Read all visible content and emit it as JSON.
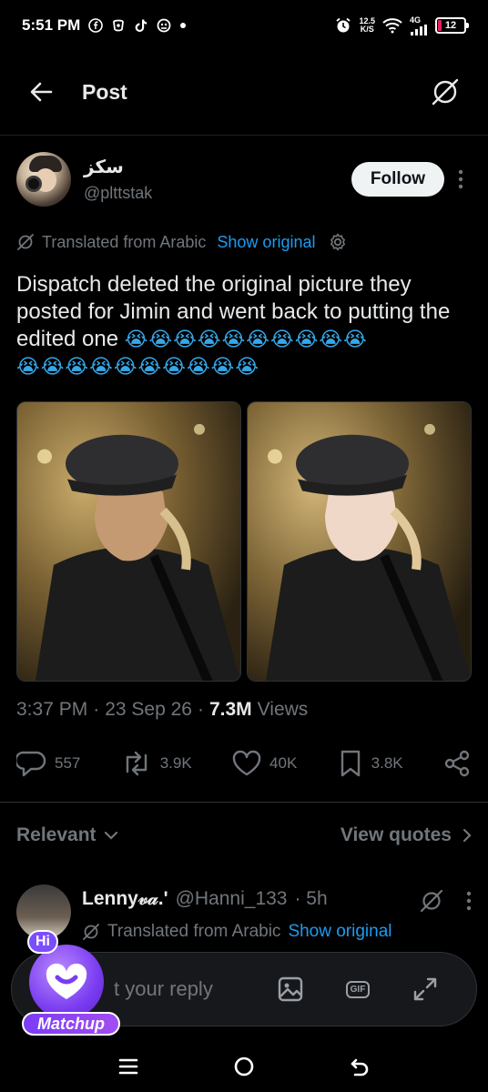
{
  "status_bar": {
    "time": "5:51 PM",
    "net_speed_value": "12.5",
    "net_speed_unit": "K/S",
    "network": "4G",
    "battery": "12"
  },
  "header": {
    "title": "Post"
  },
  "tweet": {
    "author_name": "سکز",
    "author_handle": "@plttstak",
    "follow_label": "Follow",
    "translated_label": "Translated from Arabic",
    "show_original": "Show original",
    "text": "Dispatch deleted the original picture they posted for Jimin and went back to putting the edited one",
    "emojis_line1": "😭😭😭😭😭😭😭😭😭😭",
    "emojis_line2": "😭😭😭😭😭😭😭😭😭😭",
    "time": "3:37 PM",
    "date": "23 Sep 26",
    "views_count": "7.3M",
    "views_label": "Views",
    "replies": "557",
    "reposts": "3.9K",
    "likes": "40K",
    "bookmarks": "3.8K"
  },
  "replies_section": {
    "sort_label": "Relevant",
    "quotes_label": "View quotes"
  },
  "reply": {
    "name": "Lenny𝓋𝒶.'",
    "handle": "@Hanni_133",
    "age": "· 5h",
    "translated_label": "Translated from Arabic",
    "show_original": "Show original"
  },
  "composer": {
    "placeholder": "Post your reply",
    "visible_placeholder": "t your reply",
    "gif_label": "GIF"
  },
  "overlay": {
    "hi_label": "Hi",
    "app_label": "Matchup"
  },
  "colors": {
    "accent": "#1d9bf0",
    "muted": "#71767b",
    "text": "#e7e9ea",
    "background": "#000000"
  }
}
